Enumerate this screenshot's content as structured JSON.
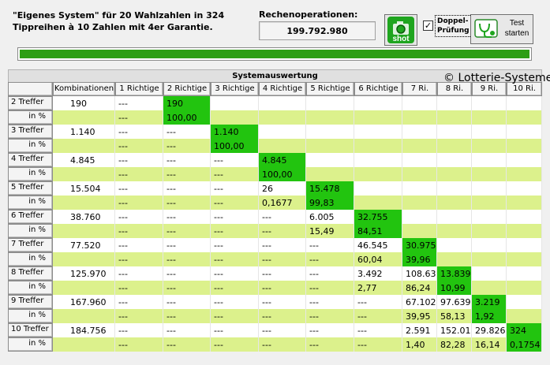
{
  "description_line1": "\"Eigenes System\" für 20 Wahlzahlen in 324",
  "description_line2": "Tippreihen à 10 Zahlen mit 4er Garantie.",
  "operations": {
    "label": "Rechenoperationen:",
    "value": "199.792.980"
  },
  "shot_button": {
    "label": "shot"
  },
  "doppel": {
    "checked": "✓",
    "label_line1": "Doppel-",
    "label_line2": "Prüfung"
  },
  "test_button": {
    "label_line1": "Test",
    "label_line2": "starten"
  },
  "progress": {
    "value": 100
  },
  "table": {
    "title": "Systemauswertung",
    "copyright": "© Lotterie-Systeme-",
    "headers": [
      "Kombinationen",
      "1 Richtige",
      "2 Richtige",
      "3 Richtige",
      "4 Richtige",
      "5 Richtige",
      "6 Richtige",
      "7 Ri.",
      "8 Ri.",
      "9 Ri.",
      "10 Ri."
    ],
    "rows": [
      {
        "label": "2 Treffer",
        "pct_label": "in %",
        "kombi": "190",
        "values": [
          "---",
          "190",
          "",
          "",
          "",
          "",
          "",
          "",
          "",
          ""
        ],
        "percents": [
          "---",
          "100,00",
          "",
          "",
          "",
          "",
          "",
          "",
          "",
          ""
        ]
      },
      {
        "label": "3 Treffer",
        "pct_label": "in %",
        "kombi": "1.140",
        "values": [
          "---",
          "---",
          "1.140",
          "",
          "",
          "",
          "",
          "",
          "",
          ""
        ],
        "percents": [
          "---",
          "---",
          "100,00",
          "",
          "",
          "",
          "",
          "",
          "",
          ""
        ]
      },
      {
        "label": "4 Treffer",
        "pct_label": "in %",
        "kombi": "4.845",
        "values": [
          "---",
          "---",
          "---",
          "4.845",
          "",
          "",
          "",
          "",
          "",
          ""
        ],
        "percents": [
          "---",
          "---",
          "---",
          "100,00",
          "",
          "",
          "",
          "",
          "",
          ""
        ]
      },
      {
        "label": "5 Treffer",
        "pct_label": "in %",
        "kombi": "15.504",
        "values": [
          "---",
          "---",
          "---",
          "26",
          "15.478",
          "",
          "",
          "",
          "",
          ""
        ],
        "percents": [
          "---",
          "---",
          "---",
          "0,1677",
          "99,83",
          "",
          "",
          "",
          "",
          ""
        ]
      },
      {
        "label": "6 Treffer",
        "pct_label": "in %",
        "kombi": "38.760",
        "values": [
          "---",
          "---",
          "---",
          "---",
          "6.005",
          "32.755",
          "",
          "",
          "",
          ""
        ],
        "percents": [
          "---",
          "---",
          "---",
          "---",
          "15,49",
          "84,51",
          "",
          "",
          "",
          ""
        ]
      },
      {
        "label": "7 Treffer",
        "pct_label": "in %",
        "kombi": "77.520",
        "values": [
          "---",
          "---",
          "---",
          "---",
          "---",
          "46.545",
          "30.975",
          "",
          "",
          ""
        ],
        "percents": [
          "---",
          "---",
          "---",
          "---",
          "---",
          "60,04",
          "39,96",
          "",
          "",
          ""
        ]
      },
      {
        "label": "8 Treffer",
        "pct_label": "in %",
        "kombi": "125.970",
        "values": [
          "---",
          "---",
          "---",
          "---",
          "---",
          "3.492",
          "108.639",
          "13.839",
          "",
          ""
        ],
        "percents": [
          "---",
          "---",
          "---",
          "---",
          "---",
          "2,77",
          "86,24",
          "10,99",
          "",
          ""
        ]
      },
      {
        "label": "9 Treffer",
        "pct_label": "in %",
        "kombi": "167.960",
        "values": [
          "---",
          "---",
          "---",
          "---",
          "---",
          "---",
          "67.102",
          "97.639",
          "3.219",
          ""
        ],
        "percents": [
          "---",
          "---",
          "---",
          "---",
          "---",
          "---",
          "39,95",
          "58,13",
          "1,92",
          ""
        ]
      },
      {
        "label": "10 Treffer",
        "pct_label": "in %",
        "kombi": "184.756",
        "values": [
          "---",
          "---",
          "---",
          "---",
          "---",
          "---",
          "2.591",
          "152.015",
          "29.826",
          "324"
        ],
        "percents": [
          "---",
          "---",
          "---",
          "---",
          "---",
          "---",
          "1,40",
          "82,28",
          "16,14",
          "0,1754"
        ]
      }
    ]
  },
  "colors": {
    "highlight": "#22c40f",
    "band": "#dcf18c",
    "progress": "#2e9e15"
  }
}
